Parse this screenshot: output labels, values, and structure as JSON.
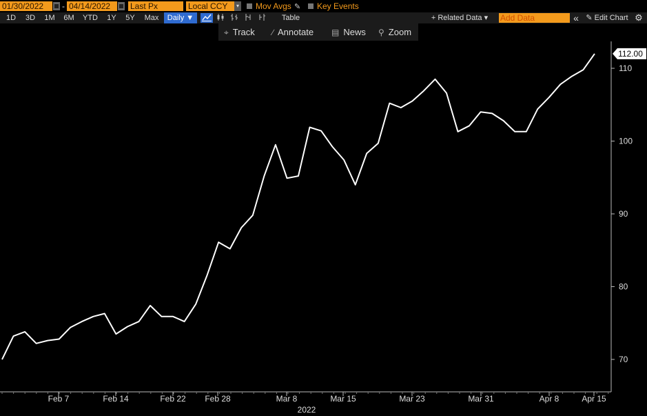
{
  "header": {
    "start_date": "01/30/2022",
    "date_separator": "-",
    "end_date": "04/14/2022",
    "price_field": "Last Px",
    "currency_field": "Local CCY",
    "mov_avgs_label": "Mov Avgs",
    "key_events_label": "Key Events"
  },
  "range_bar": {
    "ranges": [
      "1D",
      "3D",
      "1M",
      "6M",
      "YTD",
      "1Y",
      "5Y",
      "Max"
    ],
    "frequency": "Daily ▼",
    "table_label": "Table",
    "related_data_label": "+ Related Data ▾",
    "add_data_placeholder": "Add Data",
    "collapse_icon": "«",
    "edit_chart_label": "✎ Edit Chart",
    "settings_icon": "⚙"
  },
  "chart_toolbar": {
    "track": "Track",
    "annotate": "Annotate",
    "news": "News",
    "zoom": "Zoom"
  },
  "chart_data": {
    "type": "line",
    "colors": {
      "line": "#ffffff",
      "background": "#000000",
      "price_tag_bg": "#ffffff"
    },
    "last_value_label": "112.00",
    "y_ticks": [
      70,
      80,
      90,
      100,
      110
    ],
    "ylim": [
      66,
      113.5
    ],
    "x_tick_labels": [
      "Feb 7",
      "Feb 14",
      "Feb 22",
      "Feb 28",
      "Mar 8",
      "Mar 15",
      "Mar 23",
      "Mar 31",
      "Apr 8",
      "Apr 15"
    ],
    "year_label": "2022",
    "series": [
      {
        "values": [
          70.0,
          73.2,
          73.8,
          72.2,
          72.6,
          72.8,
          74.4,
          75.2,
          75.9,
          76.3,
          73.5,
          74.5,
          75.2,
          77.4,
          75.9,
          75.9,
          75.2,
          77.6,
          81.6,
          86.1,
          85.2,
          88.1,
          89.8,
          95.2,
          99.5,
          94.9,
          95.2,
          101.9,
          101.4,
          99.2,
          97.4,
          94.0,
          98.3,
          99.7,
          105.2,
          104.6,
          105.5,
          106.9,
          108.5,
          106.6,
          101.3,
          102.1,
          104.0,
          103.8,
          102.8,
          101.3,
          101.3,
          104.4,
          106.0,
          107.8,
          108.9,
          109.8,
          112.0
        ]
      }
    ]
  }
}
